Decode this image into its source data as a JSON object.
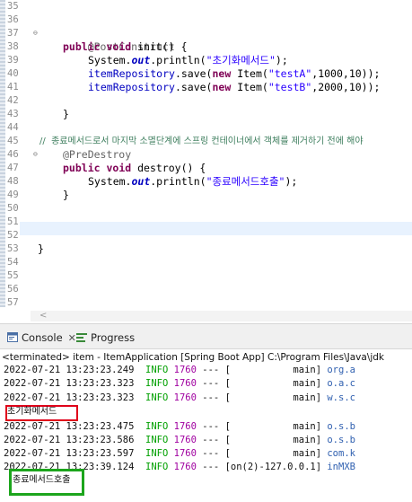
{
  "editor": {
    "line_numbers": [
      "35",
      "36",
      "37",
      "38",
      "39",
      "40",
      "41",
      "42",
      "43",
      "44",
      "45",
      "46",
      "47",
      "48",
      "49",
      "50",
      "51",
      "52",
      "53",
      "54",
      "55",
      "56",
      "57"
    ],
    "fold_markers": {
      "37": "⊖",
      "46": "⊖"
    },
    "lines": {
      "37": {
        "ann": "@PostConstruct"
      },
      "38": {
        "kw1": "public",
        "kw2": "void",
        "rest": " init() {"
      },
      "39": {
        "pre": "System.",
        "fld": "out",
        "mid": ".println(",
        "str": "\"초기화메서드\"",
        "post": ");"
      },
      "40": {
        "fld": "itemRepository",
        "mid": ".save(",
        "kw": "new",
        "mid2": " Item(",
        "str": "\"testA\"",
        "post": ",1000,10));"
      },
      "41": {
        "fld": "itemRepository",
        "mid": ".save(",
        "kw": "new",
        "mid2": " Item(",
        "str": "\"testB\"",
        "post": ",2000,10));"
      },
      "43": {
        "text": "}"
      },
      "45": {
        "cmt": "//  종료메서드로서 마지막 소멸단계에 스프링 컨테이너에서 객체를 제거하기 전에 해야"
      },
      "46": {
        "ann": "@PreDestroy"
      },
      "47": {
        "kw1": "public",
        "kw2": "void",
        "rest": " destroy() {"
      },
      "48": {
        "pre": "System.",
        "fld": "out",
        "mid": ".println(",
        "str": "\"종료메서드호출\"",
        "post": ");"
      },
      "49": {
        "text": "}"
      },
      "53": {
        "text": "}"
      }
    },
    "scroll_left_arrow": "<"
  },
  "console": {
    "tabs": [
      {
        "label": "Console",
        "close": "✕"
      },
      {
        "label": "Progress"
      }
    ],
    "status": "<terminated> item - ItemApplication [Spring Boot App] C:\\Program Files\\Java\\jdk",
    "logs": [
      {
        "ts": "2022-07-21 13:23:23.249",
        "lvl": "INFO",
        "pid": "1760",
        "dash": "---",
        "thread": "[           main]",
        "cls": "org.a"
      },
      {
        "ts": "2022-07-21 13:23:23.323",
        "lvl": "INFO",
        "pid": "1760",
        "dash": "---",
        "thread": "[           main]",
        "cls": "o.a.c"
      },
      {
        "ts": "2022-07-21 13:23:23.323",
        "lvl": "INFO",
        "pid": "1760",
        "dash": "---",
        "thread": "[           main]",
        "cls": "w.s.c"
      },
      {
        "ts": "2022-07-21 13:23:23.475",
        "lvl": "INFO",
        "pid": "1760",
        "dash": "---",
        "thread": "[           main]",
        "cls": "o.s.b"
      },
      {
        "ts": "2022-07-21 13:23:23.586",
        "lvl": "INFO",
        "pid": "1760",
        "dash": "---",
        "thread": "[           main]",
        "cls": "o.s.b"
      },
      {
        "ts": "2022-07-21 13:23:23.597",
        "lvl": "INFO",
        "pid": "1760",
        "dash": "---",
        "thread": "[           main]",
        "cls": "com.k"
      },
      {
        "ts": "2022-07-21 13:23:39.124",
        "lvl": "INFO",
        "pid": "1760",
        "dash": "---",
        "thread": "[on(2)-127.0.0.1]",
        "cls": "inMXB"
      }
    ],
    "init_output": "초기화메서드",
    "destroy_output": "종료메서드호출"
  }
}
